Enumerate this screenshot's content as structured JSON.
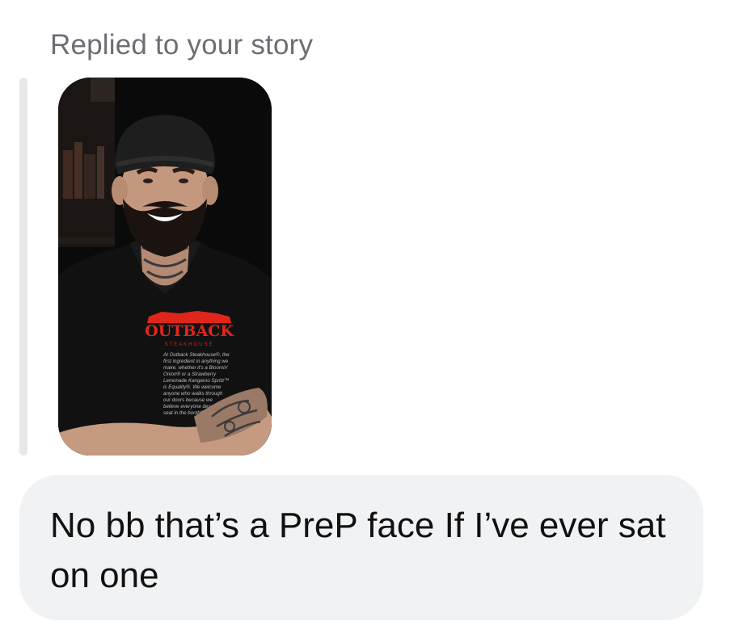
{
  "reply_header": {
    "label": "Replied to your story"
  },
  "story": {
    "brand_name": "OUTBACK",
    "brand_sub": "STEAKHOUSE",
    "shirt_caption_lines": [
      "At Outback Steakhouse®, the",
      "first ingredient in anything we",
      "make, whether it's a Bloomin'",
      "Onion® or a Strawberry",
      "Lemonade Kangaroo Spritz™",
      "is Equality®. We welcome",
      "anyone who walks through",
      "our doors because we",
      "believe everyone deserves a",
      "seat in the booth®"
    ],
    "brand_color": "#e0261b"
  },
  "message": {
    "text": "No bb that’s a PreP face If I’ve ever sat on one"
  }
}
